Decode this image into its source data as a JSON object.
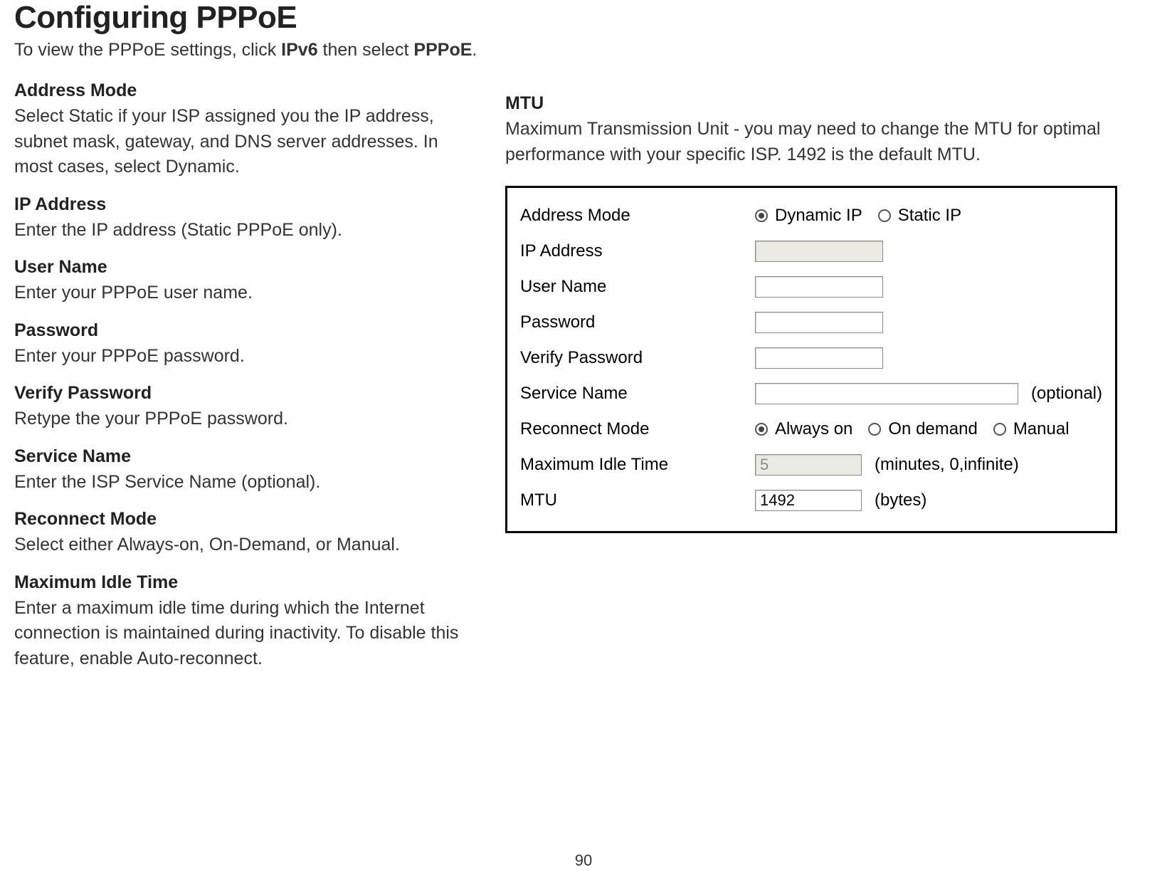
{
  "title": "Configuring PPPoE",
  "subtitle": {
    "pre": "To view the PPPoE settings, click ",
    "b1": "IPv6",
    "mid": " then select ",
    "b2": "PPPoE",
    "post": "."
  },
  "left": [
    {
      "term": "Address Mode",
      "desc": "Select Static if your ISP assigned you the IP address, subnet mask, gateway, and DNS server addresses. In most cases, select Dynamic."
    },
    {
      "term": "IP Address",
      "desc": "Enter the IP address (Static PPPoE only)."
    },
    {
      "term": "User Name",
      "desc": "Enter your PPPoE user name."
    },
    {
      "term": "Password",
      "desc": "Enter your PPPoE password."
    },
    {
      "term": "Verify Password",
      "desc": "Retype the your PPPoE password."
    },
    {
      "term": "Service Name",
      "desc": "Enter the ISP Service Name (optional)."
    },
    {
      "term": "Reconnect Mode",
      "desc": "Select either Always-on, On-Demand, or Manual."
    },
    {
      "term": "Maximum Idle Time",
      "desc": "Enter a maximum idle time during which the Internet connection is maintained during inactivity. To disable this feature, enable Auto-reconnect."
    }
  ],
  "mtu": {
    "term": "MTU",
    "desc": "Maximum Transmission Unit - you may need to change the MTU for optimal performance with your specific ISP. 1492 is the default MTU."
  },
  "form": {
    "address_mode": {
      "label": "Address Mode",
      "opt1": "Dynamic IP",
      "opt2": "Static IP",
      "selected": "Dynamic IP"
    },
    "ip_address": {
      "label": "IP Address",
      "value": ""
    },
    "user_name": {
      "label": "User Name",
      "value": ""
    },
    "password": {
      "label": "Password",
      "value": ""
    },
    "verify_password": {
      "label": "Verify Password",
      "value": ""
    },
    "service_name": {
      "label": "Service Name",
      "value": "",
      "hint": "(optional)"
    },
    "reconnect_mode": {
      "label": "Reconnect Mode",
      "opt1": "Always on",
      "opt2": "On demand",
      "opt3": "Manual",
      "selected": "Always on"
    },
    "max_idle": {
      "label": "Maximum Idle Time",
      "value": "5",
      "hint": "(minutes, 0,infinite)"
    },
    "mtu": {
      "label": "MTU",
      "value": "1492",
      "hint": "(bytes)"
    }
  },
  "page_number": "90"
}
